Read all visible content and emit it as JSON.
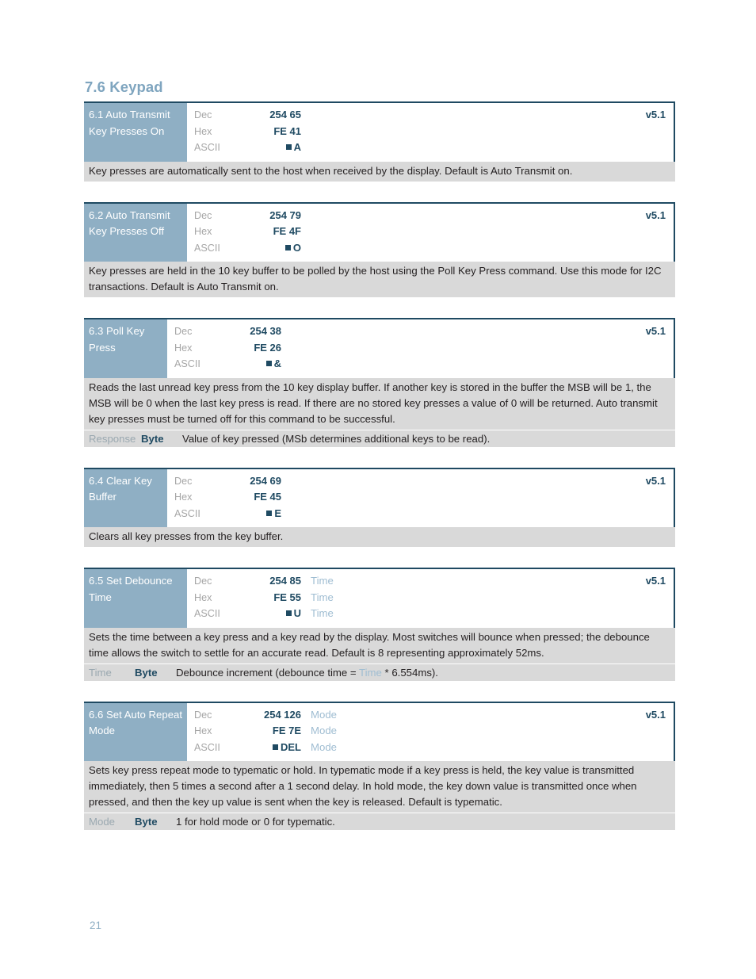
{
  "section": {
    "heading": "7.6 Keypad"
  },
  "colors": {
    "accent_blue": "#8fafc4",
    "dark_navy": "#1f4a62",
    "desc_background": "#d9d9d9",
    "param_label": "#9fbdd2"
  },
  "commands": [
    {
      "id": "6.1",
      "label": "6.1 Auto Transmit Key Presses On",
      "label_width": "wide",
      "version": "v5.1",
      "rows": [
        {
          "type": "Dec",
          "value": "254 65",
          "param": ""
        },
        {
          "type": "Hex",
          "value": "FE 41",
          "param": ""
        },
        {
          "type": "ASCII",
          "value": "A",
          "param": "",
          "square": true
        }
      ],
      "description": "Key presses are automatically sent to the host when received by the display.  Default is Auto Transmit on.",
      "param_row": null
    },
    {
      "id": "6.2",
      "label": "6.2 Auto Transmit Key Presses Off",
      "label_width": "wide",
      "version": "v5.1",
      "rows": [
        {
          "type": "Dec",
          "value": "254 79",
          "param": ""
        },
        {
          "type": "Hex",
          "value": "FE 4F",
          "param": ""
        },
        {
          "type": "ASCII",
          "value": "O",
          "param": "",
          "square": true
        }
      ],
      "description": "Key presses are held in the 10 key buffer to be polled by the host using the Poll Key Press command.  Use this mode for I2C transactions.  Default is Auto Transmit on.",
      "param_row": null
    },
    {
      "id": "6.3",
      "label": "6.3 Poll Key Press",
      "label_width": "narrow",
      "version": "v5.1",
      "rows": [
        {
          "type": "Dec",
          "value": "254 38",
          "param": ""
        },
        {
          "type": "Hex",
          "value": "FE 26",
          "param": ""
        },
        {
          "type": "ASCII",
          "value": "&",
          "param": "",
          "square": true
        }
      ],
      "description": "Reads the last unread key press from the 10 key display buffer.  If another key is stored in the buffer the MSB will be 1, the MSB will be 0 when the last key press is read.  If there are no stored key presses a value of 0 will be returned.  Auto transmit key presses must be turned off for this command to be successful.",
      "param_row": {
        "name": "Response",
        "size": "Byte",
        "desc": "Value of key pressed (MSb determines additional keys to be read).",
        "wide_name": true
      }
    },
    {
      "id": "6.4",
      "label": "6.4 Clear Key Buffer",
      "label_width": "narrow",
      "version": "v5.1",
      "rows": [
        {
          "type": "Dec",
          "value": "254 69",
          "param": ""
        },
        {
          "type": "Hex",
          "value": "FE 45",
          "param": ""
        },
        {
          "type": "ASCII",
          "value": "E",
          "param": "",
          "square": true
        }
      ],
      "description": "Clears all key presses from the key buffer.",
      "param_row": null
    },
    {
      "id": "6.5",
      "label": "6.5 Set Debounce Time",
      "label_width": "wide",
      "version": "v5.1",
      "rows": [
        {
          "type": "Dec",
          "value": "254 85",
          "param": "Time"
        },
        {
          "type": "Hex",
          "value": "FE 55",
          "param": "Time"
        },
        {
          "type": "ASCII",
          "value": "U",
          "param": "Time",
          "square": true
        }
      ],
      "description": "Sets the time between a key press and a key read by the display.  Most switches will bounce when pressed; the debounce time allows the switch to settle for an accurate read.  Default is 8 representing approximately 52ms.",
      "param_row": {
        "name": "Time",
        "size": "Byte",
        "desc_pre": "Debounce increment (debounce time = ",
        "desc_hl": "Time",
        "desc_post": " * 6.554ms).",
        "wide_name": false
      }
    },
    {
      "id": "6.6",
      "label": "6.6 Set Auto Repeat Mode",
      "label_width": "wide",
      "version": "v5.1",
      "rows": [
        {
          "type": "Dec",
          "value": "254 126",
          "param": "Mode"
        },
        {
          "type": "Hex",
          "value": "FE 7E",
          "param": "Mode"
        },
        {
          "type": "ASCII",
          "value": "DEL",
          "param": "Mode",
          "square": true
        }
      ],
      "description": "Sets key press repeat mode to typematic or hold.  In typematic mode if a key press is held, the key value is transmitted immediately, then 5 times a second after a 1 second delay.  In hold mode, the key down value is transmitted once when pressed, and then the key up value is sent when the key is released.  Default is typematic.",
      "param_row": {
        "name": "Mode",
        "size": "Byte",
        "desc": "1 for hold mode or 0 for typematic.",
        "wide_name": false
      }
    }
  ],
  "footer": {
    "page_number": "21"
  }
}
